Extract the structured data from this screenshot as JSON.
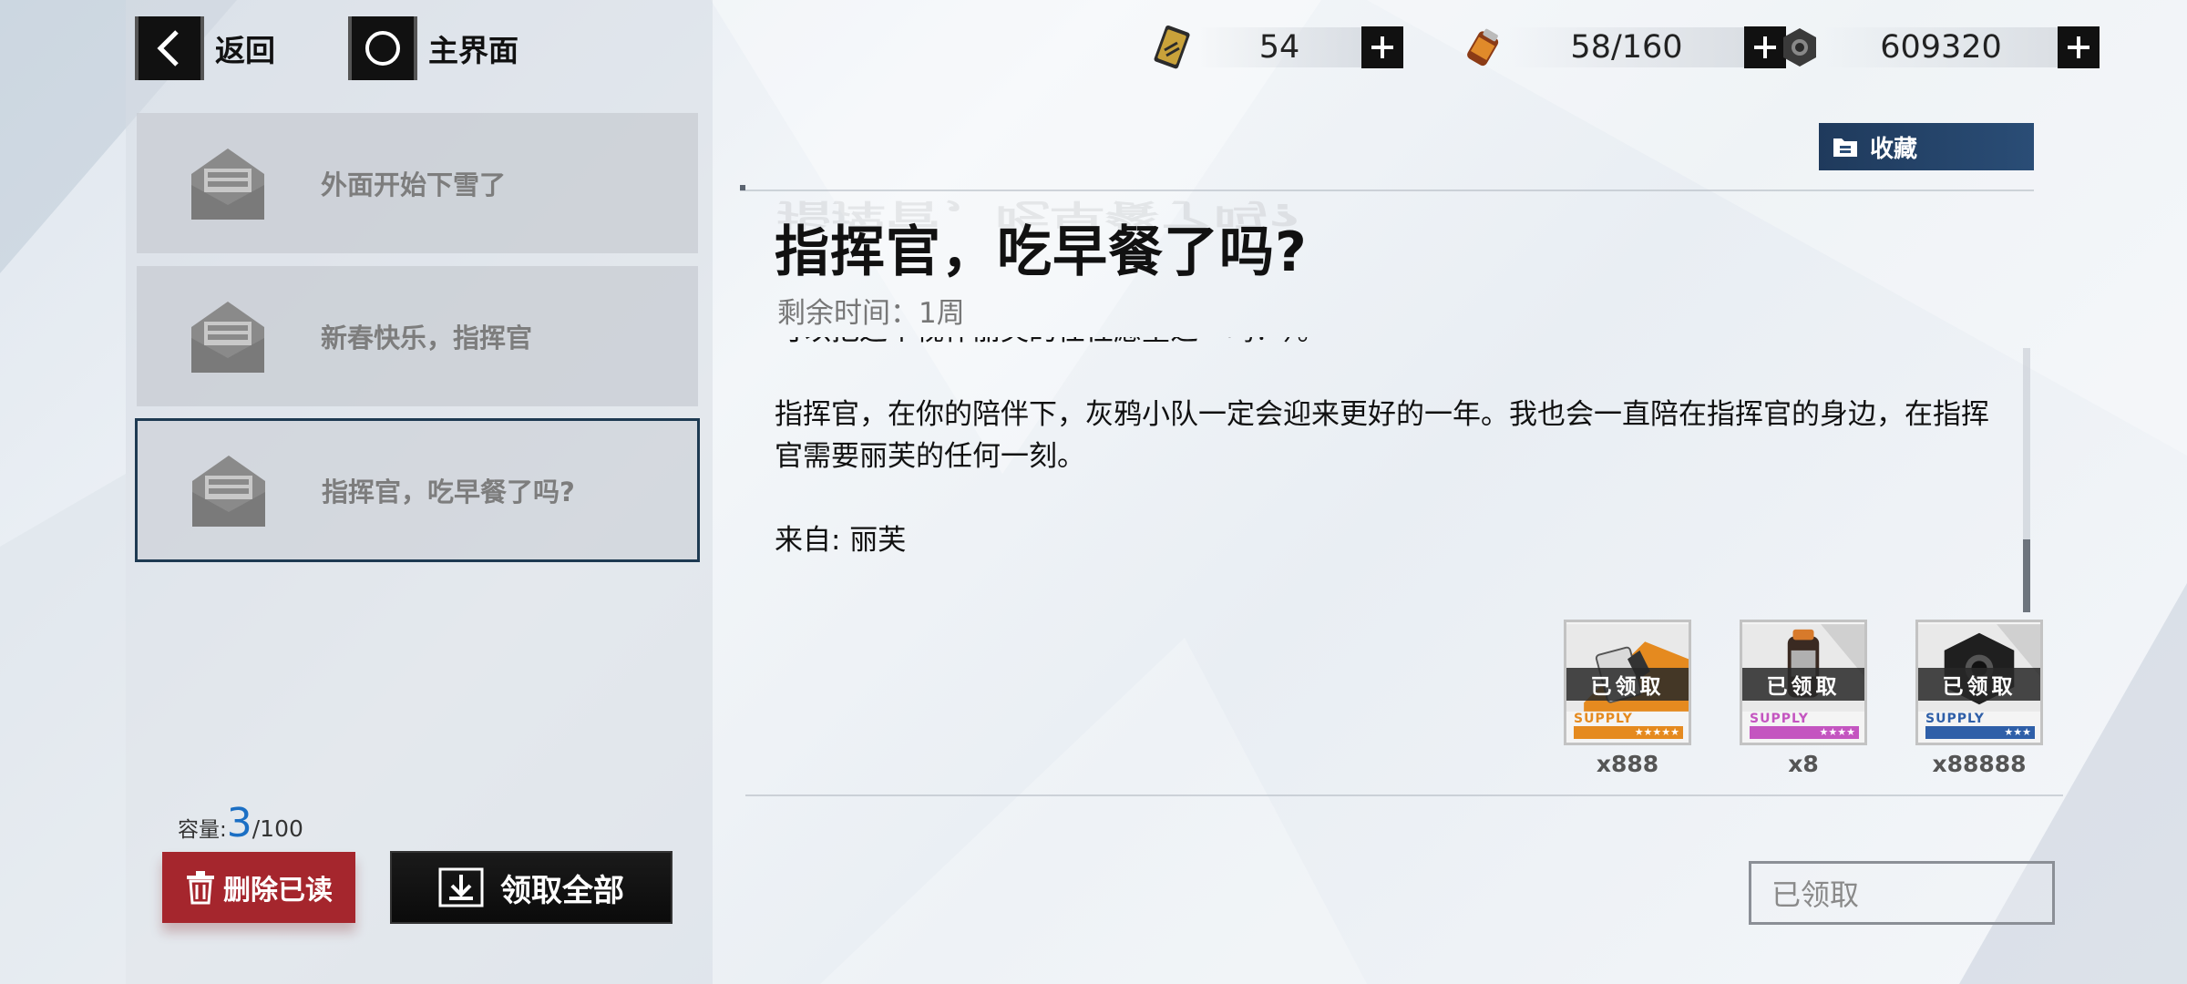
{
  "nav": {
    "back_label": "返回",
    "home_label": "主界面"
  },
  "resources": [
    {
      "icon": "card-ticket-icon",
      "value": "54"
    },
    {
      "icon": "battery-cell-icon",
      "value": "58/160"
    },
    {
      "icon": "gear-nut-icon",
      "value": "609320"
    }
  ],
  "mail_list": [
    {
      "title": "外面开始下雪了",
      "selected": false
    },
    {
      "title": "新春快乐，指挥官",
      "selected": false
    },
    {
      "title": "指挥官，吃早餐了吗?",
      "selected": true
    }
  ],
  "capacity": {
    "label": "容量:",
    "current": "3",
    "max": "/100"
  },
  "actions": {
    "delete_read_label": "删除已读",
    "claim_all_label": "领取全部",
    "favorite_label": "收藏",
    "claimed_button_label": "已领取"
  },
  "mail": {
    "title": "指挥官，吃早餐了吗?",
    "remaining_time": "剩余时间：1周",
    "body_partial_top": "可以把这个视作丽芙的任性愿望之一吗？）。",
    "body_paragraph": "指挥官，在你的陪伴下，灰鸦小队一定会迎来更好的一年。我也会一直陪在指挥官的身边，在指挥官需要丽芙的任何一刻。",
    "sender": "来自: 丽芙"
  },
  "rewards": [
    {
      "icon": "card-item-icon",
      "status": "已领取",
      "supply": "SUPPLY",
      "rarity_stars": "★★★★★",
      "color": "#e58a1f",
      "qty": "x888"
    },
    {
      "icon": "battery-item-icon",
      "status": "已领取",
      "supply": "SUPPLY",
      "rarity_stars": "★★★★",
      "color": "#c455c0",
      "qty": "x8"
    },
    {
      "icon": "nut-item-icon",
      "status": "已领取",
      "supply": "SUPPLY",
      "rarity_stars": "★★★",
      "color": "#2f5fa8",
      "qty": "x88888"
    }
  ]
}
